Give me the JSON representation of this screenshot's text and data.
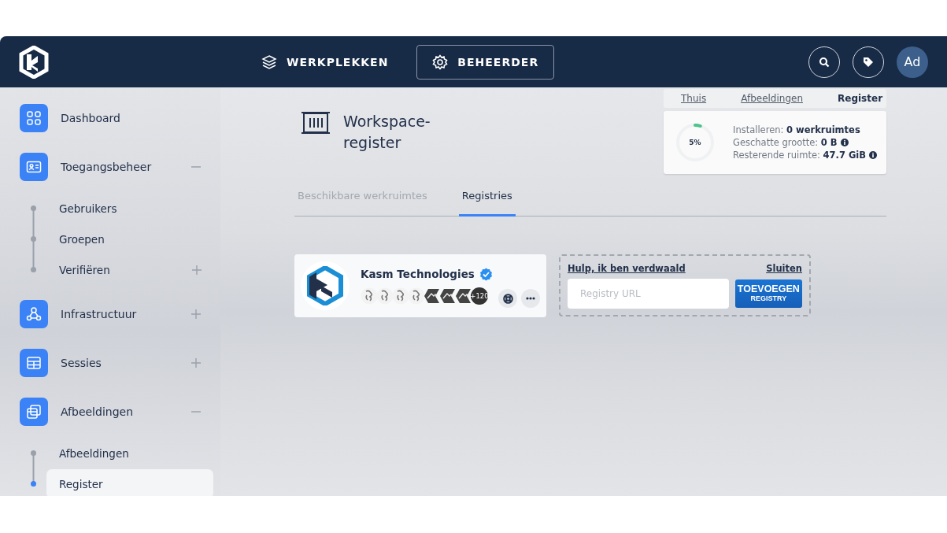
{
  "header": {
    "tabs": [
      {
        "label": "WERKPLEKKEN",
        "selected": false
      },
      {
        "label": "BEHEERDER",
        "selected": true
      }
    ],
    "avatar": "Ad"
  },
  "sidebar": {
    "items": [
      {
        "label": "Dashboard",
        "selected": false
      },
      {
        "label": "Toegangsbeheer",
        "selected": false,
        "expanded": true,
        "children": [
          {
            "label": "Gebruikers",
            "selected": false
          },
          {
            "label": "Groepen",
            "selected": false
          },
          {
            "label": "Verifiëren",
            "selected": false,
            "expanded": false
          }
        ]
      },
      {
        "label": "Infrastructuur",
        "selected": false,
        "expanded": false
      },
      {
        "label": "Sessies",
        "selected": false,
        "expanded": false
      },
      {
        "label": "Afbeeldingen",
        "selected": false,
        "expanded": true,
        "children": [
          {
            "label": "Afbeeldingen",
            "selected": false
          },
          {
            "label": "Register",
            "selected": true
          }
        ]
      }
    ]
  },
  "breadcrumb": [
    "Thuis",
    "Afbeeldingen",
    "Register"
  ],
  "install_status": {
    "level": 0.05,
    "percent": "5%",
    "lines": [
      {
        "label": "Installeren:",
        "value": "0 werkruimtes",
        "info": false
      },
      {
        "label": "Geschatte grootte:",
        "value": "0 B",
        "info": true
      },
      {
        "label": "Resterende ruimte:",
        "value": "47.7 GiB",
        "info": true
      }
    ]
  },
  "page": {
    "title": "Workspace-register",
    "tabs": [
      {
        "label": "Beschikbare werkruimtes",
        "selected": false
      },
      {
        "label": "Registries",
        "selected": true
      }
    ]
  },
  "registry": {
    "name": "Kasm Technologies",
    "verified": true,
    "more_count": "+120"
  },
  "add_form": {
    "help_link": "Hulp, ik ben verdwaald",
    "close_link": "Sluiten",
    "placeholder": "Registry URL",
    "button": [
      "TOEVOEGEN",
      "REGISTRY"
    ]
  }
}
